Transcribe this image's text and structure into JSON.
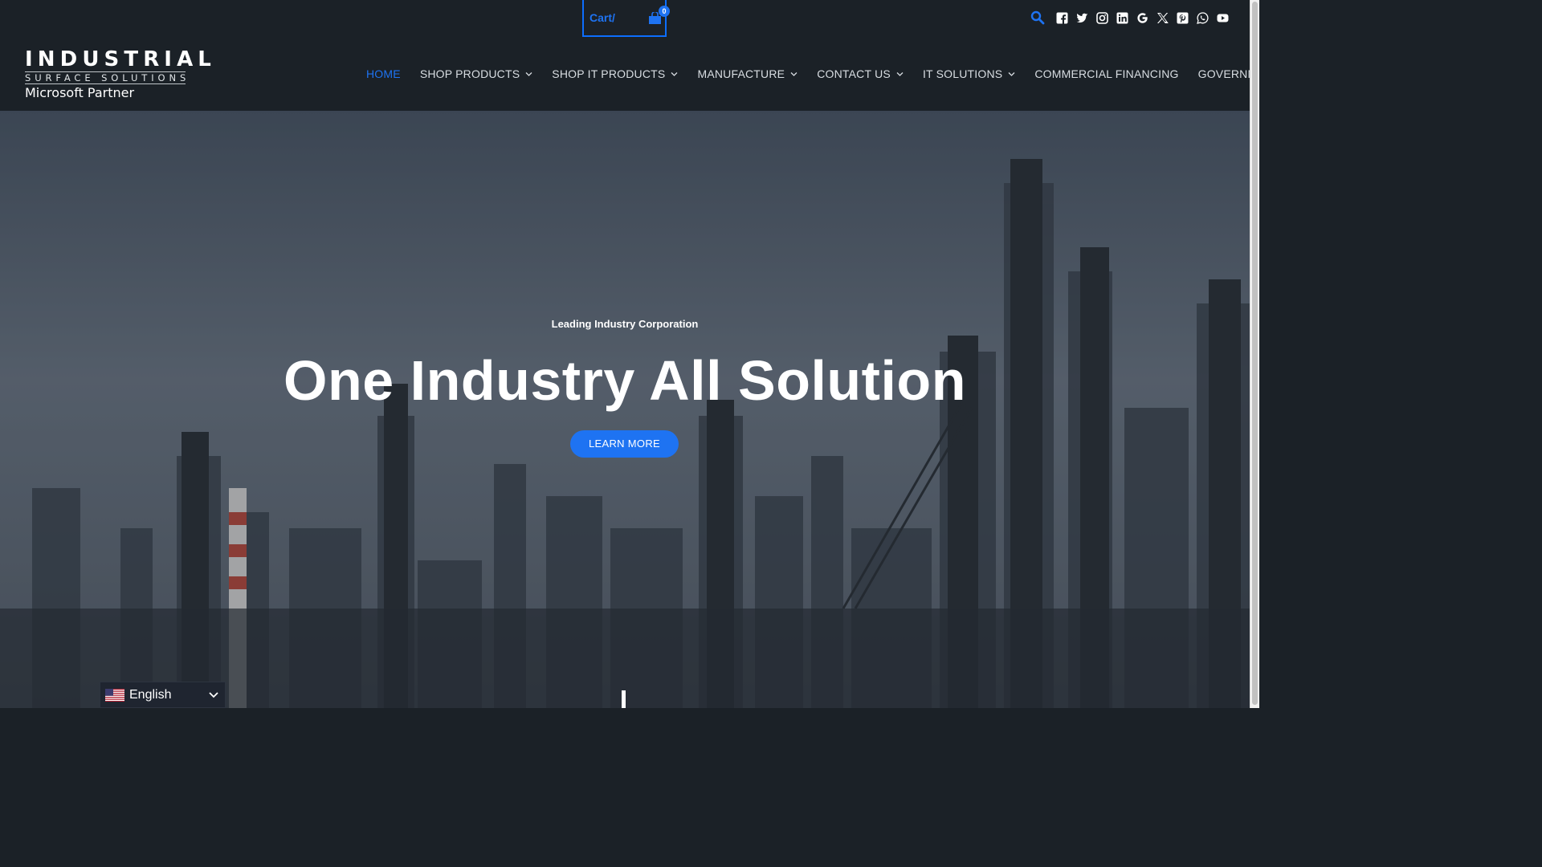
{
  "header": {
    "logo": {
      "line1": "INDUSTRIAL",
      "line2": "SURFACE SOLUTIONS",
      "line3": "Microsoft Partner"
    },
    "cart": {
      "label": "Cart/",
      "count": "0"
    },
    "search_icon": "search-icon",
    "social_icons": [
      "facebook-icon",
      "twitter-icon",
      "instagram-icon",
      "linkedin-icon",
      "google-icon",
      "x-icon",
      "pinterest-icon",
      "whatsapp-icon",
      "youtube-icon"
    ],
    "nav": [
      {
        "label": "HOME",
        "active": true,
        "dropdown": false
      },
      {
        "label": "SHOP PRODUCTS",
        "active": false,
        "dropdown": true
      },
      {
        "label": "SHOP IT PRODUCTS",
        "active": false,
        "dropdown": true
      },
      {
        "label": "MANUFACTURE",
        "active": false,
        "dropdown": true
      },
      {
        "label": "CONTACT US",
        "active": false,
        "dropdown": true
      },
      {
        "label": "IT SOLUTIONS",
        "active": false,
        "dropdown": true
      },
      {
        "label": "COMMERCIAL FINANCING",
        "active": false,
        "dropdown": false
      },
      {
        "label": "GOVERNMENT",
        "active": false,
        "dropdown": true
      }
    ]
  },
  "hero": {
    "subtitle": "Leading Industry Corporation",
    "title": "One Industry All Solution",
    "button": "LEARN MORE"
  },
  "language": {
    "label": "English",
    "flag": "us-flag-icon"
  },
  "colors": {
    "accent": "#1e73f2",
    "header_bg": "#1b2127",
    "nav_text": "#d8dde2"
  }
}
